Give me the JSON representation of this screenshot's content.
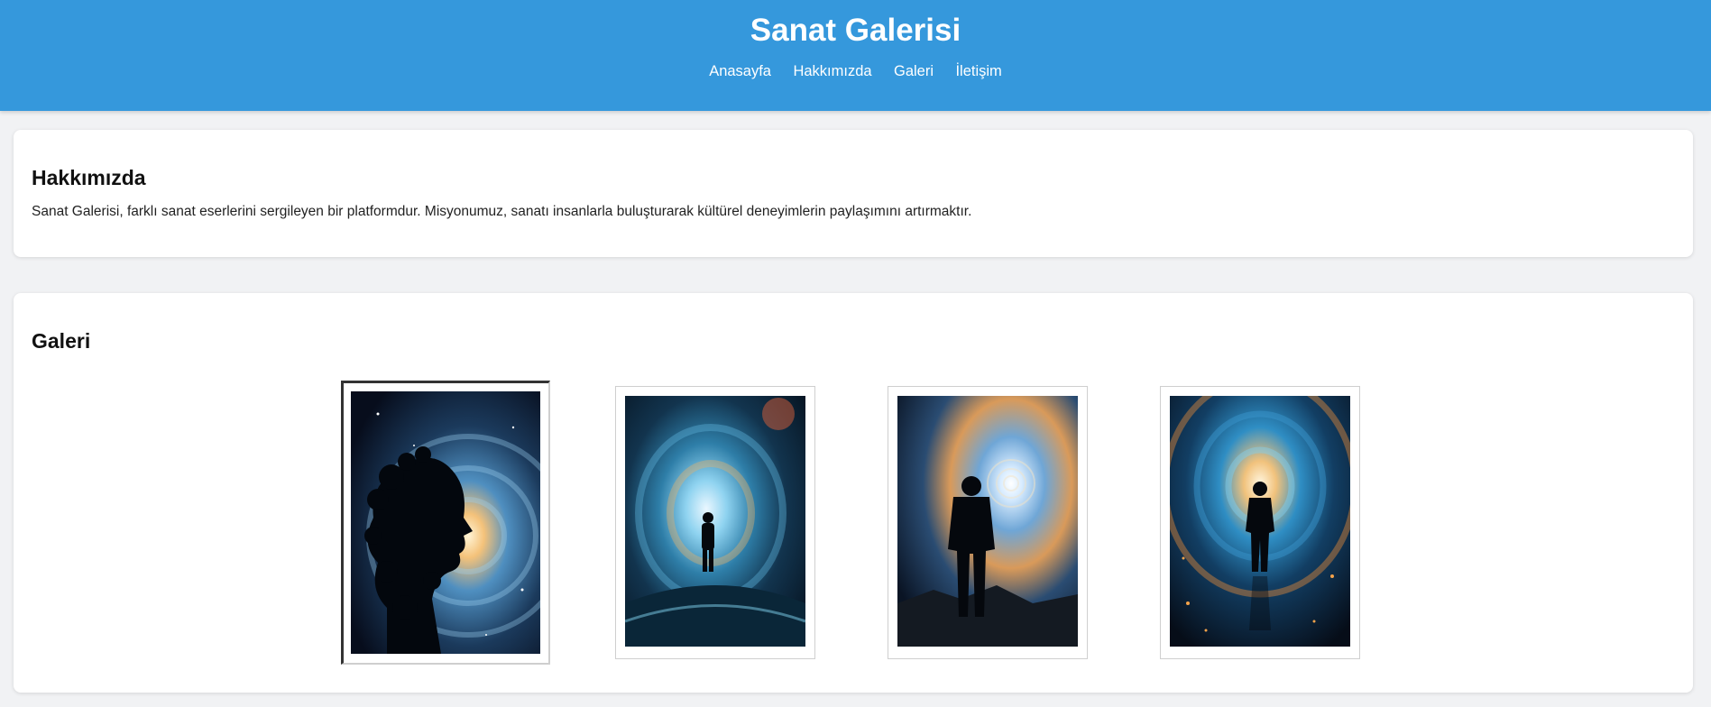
{
  "header": {
    "title": "Sanat Galerisi",
    "nav": [
      "Anasayfa",
      "Hakkımızda",
      "Galeri",
      "İletişim"
    ]
  },
  "about": {
    "heading": "Hakkımızda",
    "text": "Sanat Galerisi, farklı sanat eserlerini sergileyen bir platformdur. Misyonumuz, sanatı insanlarla buluşturarak kültürel deneyimlerin paylaşımını artırmaktır."
  },
  "gallery": {
    "heading": "Galeri",
    "artworks": [
      {
        "subject": "head-silhouette-galaxy"
      },
      {
        "subject": "figure-in-cosmic-tunnel"
      },
      {
        "subject": "figure-facing-spiral-galaxy"
      },
      {
        "subject": "figure-walking-into-vortex"
      }
    ]
  },
  "colors": {
    "header_bg": "#3598dc",
    "page_bg": "#f1f2f4",
    "card_bg": "#ffffff"
  }
}
